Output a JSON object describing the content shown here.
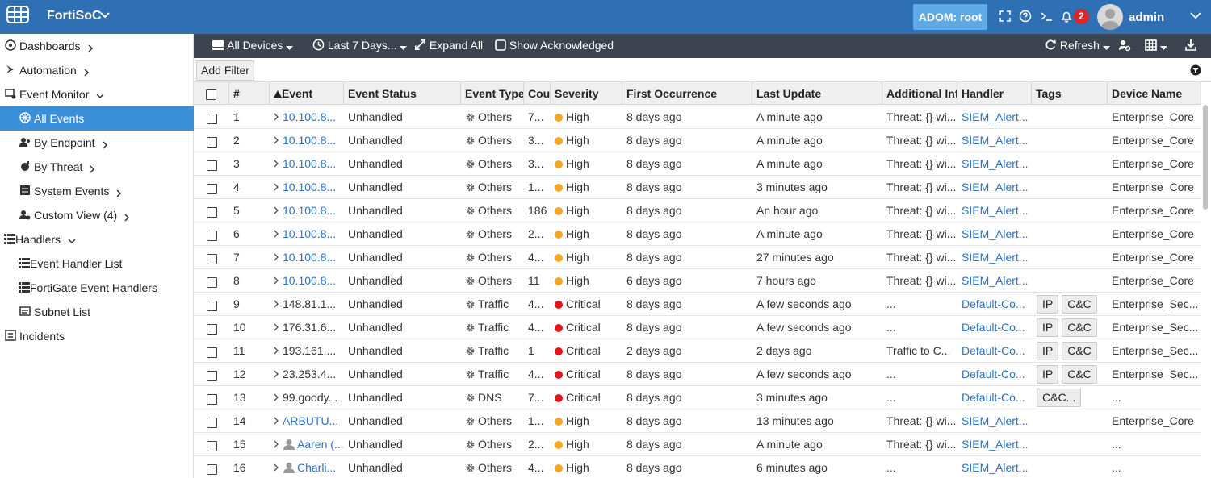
{
  "header": {
    "app_name": "FortiSoC",
    "adom_label": "ADOM: root",
    "notification_count": "2",
    "user_name": "admin",
    "colors": {
      "bar": "#2f6fb3",
      "adom": "#5ea9e6",
      "badge": "#d9262a"
    }
  },
  "sidebar": {
    "items": [
      {
        "label": "Dashboards",
        "icon": "dashboard-icon",
        "level": 0,
        "chevron": "right"
      },
      {
        "label": "Automation",
        "icon": "automation-icon",
        "level": 0,
        "chevron": "right"
      },
      {
        "label": "Event Monitor",
        "icon": "monitor-icon",
        "level": 0,
        "chevron": "down"
      },
      {
        "label": "All Events",
        "icon": "all-events-icon",
        "level": 1,
        "active": true
      },
      {
        "label": "By Endpoint",
        "icon": "endpoint-icon",
        "level": 1,
        "chevron": "right"
      },
      {
        "label": "By Threat",
        "icon": "threat-icon",
        "level": 1,
        "chevron": "right"
      },
      {
        "label": "System Events",
        "icon": "system-events-icon",
        "level": 1,
        "chevron": "right"
      },
      {
        "label": "Custom View (4)",
        "icon": "custom-view-icon",
        "level": 1,
        "chevron": "right"
      },
      {
        "label": "Handlers",
        "icon": "handlers-icon",
        "level": 0,
        "chevron": "down"
      },
      {
        "label": "Event Handler List",
        "icon": "list-icon",
        "level": 1
      },
      {
        "label": "FortiGate Event Handlers",
        "icon": "list-icon",
        "level": 1
      },
      {
        "label": "Subnet List",
        "icon": "subnet-icon",
        "level": 1
      },
      {
        "label": "Incidents",
        "icon": "incidents-icon",
        "level": 0
      }
    ]
  },
  "toolbar": {
    "devices": "All Devices",
    "time_range": "Last 7 Days...",
    "expand_all": "Expand All",
    "show_acknowledged": "Show Acknowledged",
    "refresh": "Refresh"
  },
  "filter": {
    "add_filter": "Add Filter"
  },
  "table": {
    "columns": [
      "#",
      "Event",
      "Event Status",
      "Event Type",
      "Count",
      "Severity",
      "First Occurrence",
      "Last Update",
      "Additional Info",
      "Handler",
      "Tags",
      "Device Name"
    ],
    "rows": [
      {
        "num": "1",
        "event": "10.100.8...",
        "event_link": true,
        "status": "Unhandled",
        "type": "Others",
        "count": "7...",
        "severity": "High",
        "first": "8 days ago",
        "last": "A minute ago",
        "info": "Threat: {} wi...",
        "handler": "SIEM_Alert...",
        "tags": [],
        "device": "Enterprise_Core"
      },
      {
        "num": "2",
        "event": "10.100.8...",
        "event_link": true,
        "status": "Unhandled",
        "type": "Others",
        "count": "3...",
        "severity": "High",
        "first": "8 days ago",
        "last": "A minute ago",
        "info": "Threat: {} wi...",
        "handler": "SIEM_Alert...",
        "tags": [],
        "device": "Enterprise_Core"
      },
      {
        "num": "3",
        "event": "10.100.8...",
        "event_link": true,
        "status": "Unhandled",
        "type": "Others",
        "count": "3...",
        "severity": "High",
        "first": "8 days ago",
        "last": "A minute ago",
        "info": "Threat: {} wi...",
        "handler": "SIEM_Alert...",
        "tags": [],
        "device": "Enterprise_Core"
      },
      {
        "num": "4",
        "event": "10.100.8...",
        "event_link": true,
        "status": "Unhandled",
        "type": "Others",
        "count": "1...",
        "severity": "High",
        "first": "8 days ago",
        "last": "3 minutes ago",
        "info": "Threat: {} wi...",
        "handler": "SIEM_Alert...",
        "tags": [],
        "device": "Enterprise_Core"
      },
      {
        "num": "5",
        "event": "10.100.8...",
        "event_link": true,
        "status": "Unhandled",
        "type": "Others",
        "count": "186",
        "severity": "High",
        "first": "8 days ago",
        "last": "An hour ago",
        "info": "Threat: {} wi...",
        "handler": "SIEM_Alert...",
        "tags": [],
        "device": "Enterprise_Core"
      },
      {
        "num": "6",
        "event": "10.100.8...",
        "event_link": true,
        "status": "Unhandled",
        "type": "Others",
        "count": "2...",
        "severity": "High",
        "first": "8 days ago",
        "last": "A minute ago",
        "info": "Threat: {} wi...",
        "handler": "SIEM_Alert...",
        "tags": [],
        "device": "Enterprise_Core"
      },
      {
        "num": "7",
        "event": "10.100.8...",
        "event_link": true,
        "status": "Unhandled",
        "type": "Others",
        "count": "4...",
        "severity": "High",
        "first": "8 days ago",
        "last": "27 minutes ago",
        "info": "Threat: {} wi...",
        "handler": "SIEM_Alert...",
        "tags": [],
        "device": "Enterprise_Core"
      },
      {
        "num": "8",
        "event": "10.100.8...",
        "event_link": true,
        "status": "Unhandled",
        "type": "Others",
        "count": "11",
        "severity": "High",
        "first": "6 days ago",
        "last": "7 hours ago",
        "info": "Threat: {} wi...",
        "handler": "SIEM_Alert...",
        "tags": [],
        "device": "Enterprise_Core"
      },
      {
        "num": "9",
        "event": "148.81.1...",
        "event_link": false,
        "status": "Unhandled",
        "type": "Traffic",
        "count": "4...",
        "severity": "Critical",
        "first": "8 days ago",
        "last": "A few seconds ago",
        "info": "...",
        "handler": "Default-Co...",
        "tags": [
          "IP",
          "C&C"
        ],
        "device": "Enterprise_Sec..."
      },
      {
        "num": "10",
        "event": "176.31.6...",
        "event_link": false,
        "status": "Unhandled",
        "type": "Traffic",
        "count": "4...",
        "severity": "Critical",
        "first": "8 days ago",
        "last": "A few seconds ago",
        "info": "...",
        "handler": "Default-Co...",
        "tags": [
          "IP",
          "C&C"
        ],
        "device": "Enterprise_Sec..."
      },
      {
        "num": "11",
        "event": "193.161....",
        "event_link": false,
        "status": "Unhandled",
        "type": "Traffic",
        "count": "1",
        "severity": "Critical",
        "first": "2 days ago",
        "last": "2 days ago",
        "info": "Traffic to C...",
        "handler": "Default-Co...",
        "tags": [
          "IP",
          "C&C"
        ],
        "device": "Enterprise_Sec..."
      },
      {
        "num": "12",
        "event": "23.253.4...",
        "event_link": false,
        "status": "Unhandled",
        "type": "Traffic",
        "count": "4...",
        "severity": "Critical",
        "first": "8 days ago",
        "last": "A few seconds ago",
        "info": "...",
        "handler": "Default-Co...",
        "tags": [
          "IP",
          "C&C"
        ],
        "device": "Enterprise_Sec..."
      },
      {
        "num": "13",
        "event": "99.goody...",
        "event_link": false,
        "status": "Unhandled",
        "type": "DNS",
        "count": "7...",
        "severity": "Critical",
        "first": "8 days ago",
        "last": "3 minutes ago",
        "info": "...",
        "handler": "Default-Co...",
        "tags": [
          "C&C..."
        ],
        "device": "..."
      },
      {
        "num": "14",
        "event": "ARBUTU...",
        "event_link": true,
        "status": "Unhandled",
        "type": "Others",
        "count": "1...",
        "severity": "High",
        "first": "8 days ago",
        "last": "13 minutes ago",
        "info": "Threat: {} wi...",
        "handler": "SIEM_Alert...",
        "tags": [],
        "device": "Enterprise_Core"
      },
      {
        "num": "15",
        "event": "Aaren (...",
        "event_link": true,
        "event_icon": "user-group-icon",
        "status": "Unhandled",
        "type": "Others",
        "count": "2...",
        "severity": "High",
        "first": "8 days ago",
        "last": "A minute ago",
        "info": "Threat: {} wi...",
        "handler": "SIEM_Alert...",
        "tags": [],
        "device": "..."
      },
      {
        "num": "16",
        "event": "Charli...",
        "event_link": true,
        "event_icon": "user-icon",
        "status": "Unhandled",
        "type": "Others",
        "count": "4...",
        "severity": "High",
        "first": "8 days ago",
        "last": "6 minutes ago",
        "info": "...",
        "handler": "SIEM_Alert...",
        "tags": [],
        "device": "..."
      }
    ],
    "severity_colors": {
      "High": "#f5a623",
      "Critical": "#e0161b"
    },
    "sort": {
      "column": "Event",
      "direction": "ascending"
    }
  }
}
